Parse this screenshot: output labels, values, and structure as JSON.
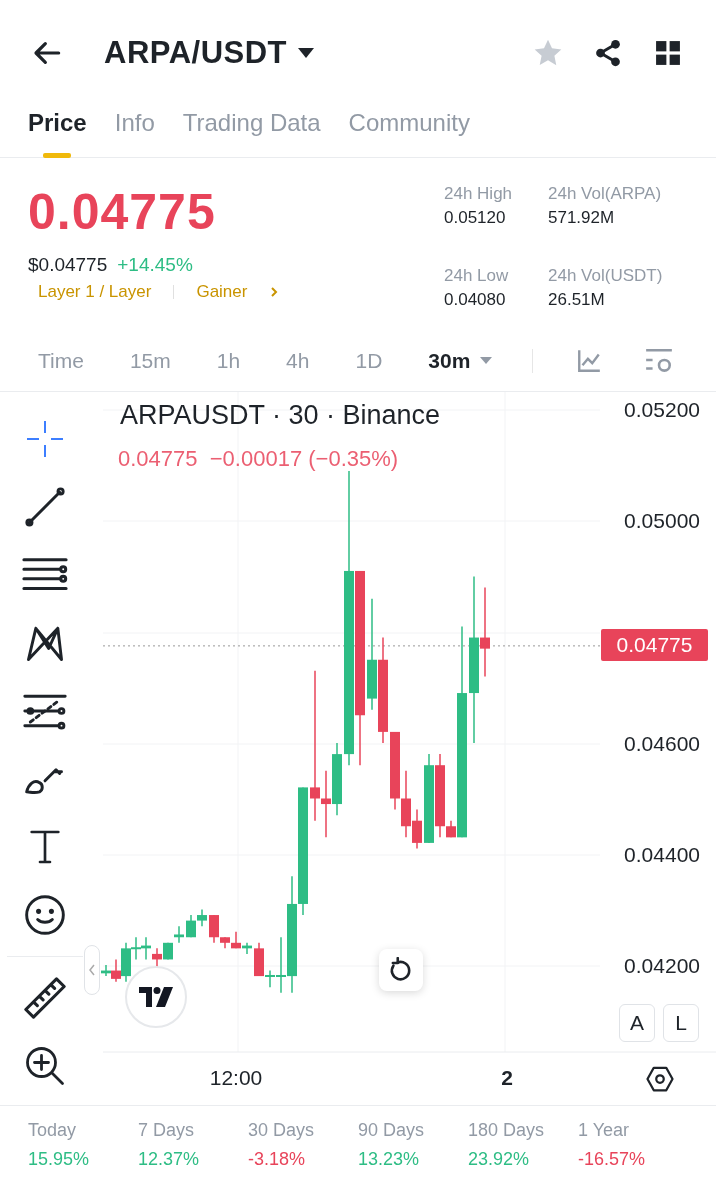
{
  "header": {
    "pair": "ARPA/USDT",
    "favorite": false
  },
  "tabs": [
    {
      "label": "Price",
      "selected": true
    },
    {
      "label": "Info",
      "selected": false
    },
    {
      "label": "Trading Data",
      "selected": false
    },
    {
      "label": "Community",
      "selected": false
    }
  ],
  "price": {
    "last": "0.04775",
    "usd": "$0.04775",
    "change": "+14.45%",
    "tags": [
      "Layer 1 / Layer",
      "Gainer"
    ]
  },
  "stats": [
    {
      "label": "24h High",
      "value": "0.05120"
    },
    {
      "label": "24h Vol(ARPA)",
      "value": "571.92M"
    },
    {
      "label": "24h Low",
      "value": "0.04080"
    },
    {
      "label": "24h Vol(USDT)",
      "value": "26.51M"
    }
  ],
  "intervals": [
    {
      "label": "Time",
      "selected": false
    },
    {
      "label": "15m",
      "selected": false
    },
    {
      "label": "1h",
      "selected": false
    },
    {
      "label": "4h",
      "selected": false
    },
    {
      "label": "1D",
      "selected": false
    },
    {
      "label": "30m",
      "selected": true
    }
  ],
  "chart": {
    "title": "ARPAUSDT · 30 · Binance",
    "ohlc_change": "0.04775  −0.00017 (−0.35%)",
    "y_labels": [
      "0.05200",
      "0.05000",
      "0.04600",
      "0.04400",
      "0.04200"
    ],
    "price_badge": "0.04775",
    "x_labels": [
      {
        "label": "12:00",
        "bold": false
      },
      {
        "label": "2",
        "bold": true
      }
    ],
    "scale_buttons": [
      "A",
      "L"
    ]
  },
  "performance": [
    {
      "label": "Today",
      "value": "15.95%",
      "color": "#2ebd85"
    },
    {
      "label": "7 Days",
      "value": "12.37%",
      "color": "#2ebd85"
    },
    {
      "label": "30 Days",
      "value": "-3.18%",
      "color": "#e8445a"
    },
    {
      "label": "90 Days",
      "value": "13.23%",
      "color": "#2ebd85"
    },
    {
      "label": "180 Days",
      "value": "23.92%",
      "color": "#2ebd85"
    },
    {
      "label": "1 Year",
      "value": "-16.57%",
      "color": "#e8445a"
    }
  ]
}
